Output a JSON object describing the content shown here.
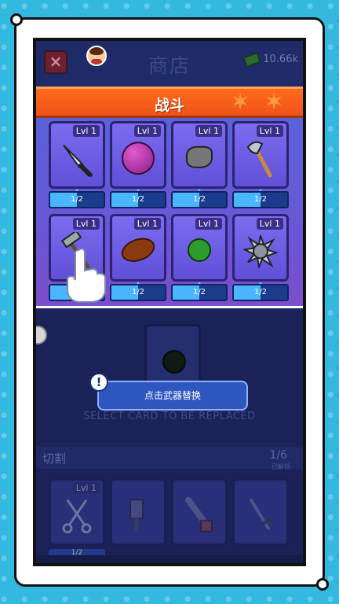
{
  "header": {
    "close_label": "×",
    "title": "商店",
    "currency_amount": "10.66k"
  },
  "banner": {
    "title": "战斗"
  },
  "weapons": [
    {
      "name": "knife",
      "level": "Lvl 1",
      "progress": "1/2",
      "progress_fraction": 0.5
    },
    {
      "name": "bowling-ball",
      "level": "Lvl 1",
      "progress": "1/2",
      "progress_fraction": 0.5
    },
    {
      "name": "rock",
      "level": "Lvl 1",
      "progress": "1/2",
      "progress_fraction": 0.5
    },
    {
      "name": "axe",
      "level": "Lvl 1",
      "progress": "1/2",
      "progress_fraction": 0.5
    },
    {
      "name": "hammer",
      "level": "Lvl 1",
      "progress": "1/2",
      "progress_fraction": 0.5
    },
    {
      "name": "football",
      "level": "Lvl 1",
      "progress": "1/2",
      "progress_fraction": 0.5
    },
    {
      "name": "grenade",
      "level": "Lvl 1",
      "progress": "1/2",
      "progress_fraction": 0.5
    },
    {
      "name": "spiked-ball",
      "level": "Lvl 1",
      "progress": "1/2",
      "progress_fraction": 0.5
    }
  ],
  "replace": {
    "toast_icon": "!",
    "toast_text": "点击武器替换",
    "hint": "SELECT CARD TO BE REPLACED"
  },
  "cutting_section": {
    "title": "切割",
    "count": "1/6",
    "sub": "已解锁",
    "cards": [
      {
        "name": "scissors",
        "level": "Lvl 1",
        "progress": "1/2"
      },
      {
        "name": "cleaver"
      },
      {
        "name": "chainsaw"
      },
      {
        "name": "sword"
      }
    ]
  }
}
